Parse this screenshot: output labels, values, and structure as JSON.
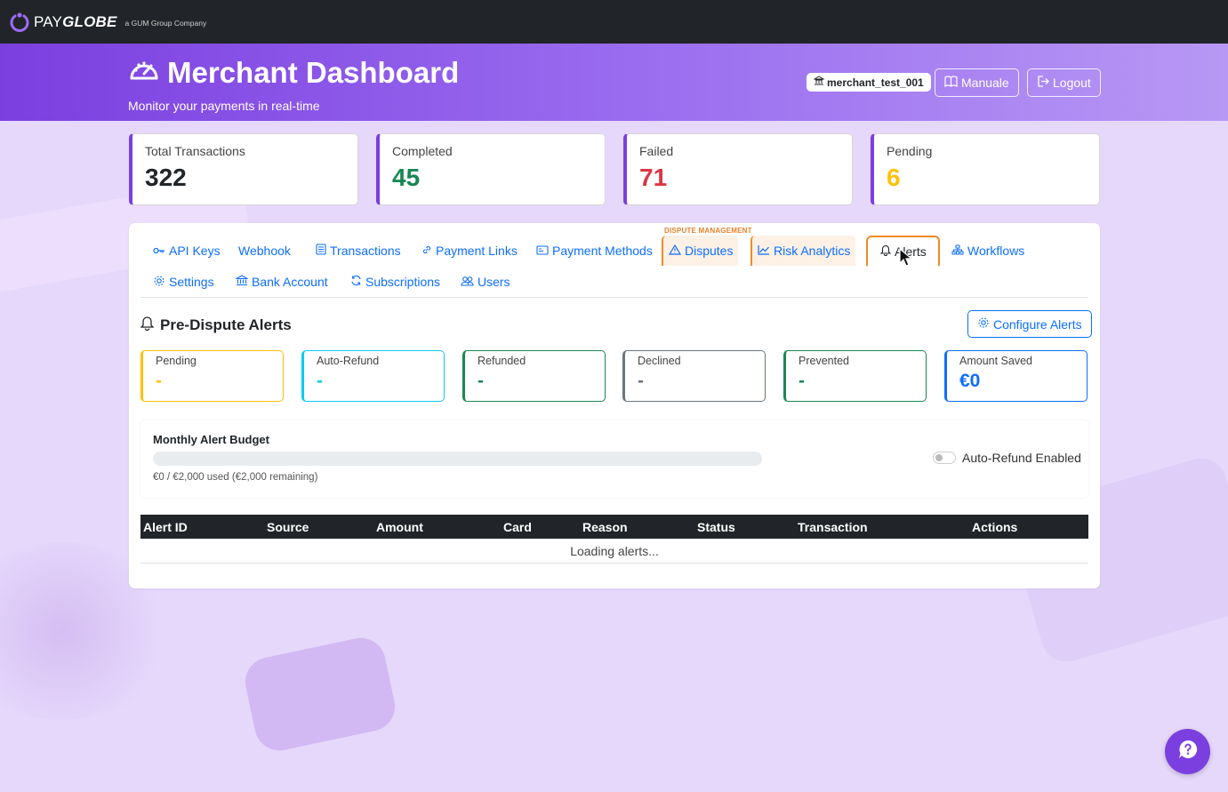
{
  "brand": {
    "name_plain": "PAY",
    "name_styled": "GLOBE",
    "tagline": "a GUM Group Company"
  },
  "header": {
    "title": "Merchant Dashboard",
    "subtitle": "Monitor your payments in real-time",
    "merchant_id": "merchant_test_001",
    "manual_label": "Manuale",
    "logout_label": "Logout"
  },
  "stats": [
    {
      "label": "Total Transactions",
      "value": "322",
      "color": "#212529"
    },
    {
      "label": "Completed",
      "value": "45",
      "color": "#198754"
    },
    {
      "label": "Failed",
      "value": "71",
      "color": "#dc3545"
    },
    {
      "label": "Pending",
      "value": "6",
      "color": "#ffc107"
    }
  ],
  "tabs": {
    "group_label": "DISPUTE MANAGEMENT",
    "items": [
      {
        "label": "API Keys",
        "icon": "key-icon"
      },
      {
        "label": "Webhook",
        "icon": ""
      },
      {
        "label": "Transactions",
        "icon": "list-icon"
      },
      {
        "label": "Payment Links",
        "icon": "link-icon"
      },
      {
        "label": "Payment Methods",
        "icon": "card-icon"
      },
      {
        "label": "Disputes",
        "icon": "warning-icon"
      },
      {
        "label": "Risk Analytics",
        "icon": "chart-icon"
      },
      {
        "label": "Alerts",
        "icon": "bell-icon",
        "active": true
      },
      {
        "label": "Workflows",
        "icon": "diagram-icon"
      },
      {
        "label": "Settings",
        "icon": "gear-icon"
      },
      {
        "label": "Bank Account",
        "icon": "bank-icon"
      },
      {
        "label": "Subscriptions",
        "icon": "refresh-icon"
      },
      {
        "label": "Users",
        "icon": "users-icon"
      }
    ]
  },
  "alerts": {
    "title": "Pre-Dispute Alerts",
    "configure_label": "Configure Alerts",
    "cards": [
      {
        "label": "Pending",
        "value": "-",
        "color": "#ffc107"
      },
      {
        "label": "Auto-Refund",
        "value": "-",
        "color": "#0dcaf0"
      },
      {
        "label": "Refunded",
        "value": "-",
        "color": "#198754"
      },
      {
        "label": "Declined",
        "value": "-",
        "color": "#6c757d"
      },
      {
        "label": "Prevented",
        "value": "-",
        "color": "#198754"
      },
      {
        "label": "Amount Saved",
        "value": "€0",
        "color": "#0d6efd"
      }
    ],
    "budget": {
      "title": "Monthly Alert Budget",
      "used_fraction": 0,
      "usage_text": "€0 / €2,000 used (€2,000 remaining)",
      "auto_refund_label": "Auto-Refund Enabled"
    },
    "table": {
      "columns": [
        "Alert ID",
        "Source",
        "Amount",
        "Card",
        "Reason",
        "Status",
        "Transaction",
        "Actions"
      ],
      "loading_text": "Loading alerts..."
    }
  }
}
